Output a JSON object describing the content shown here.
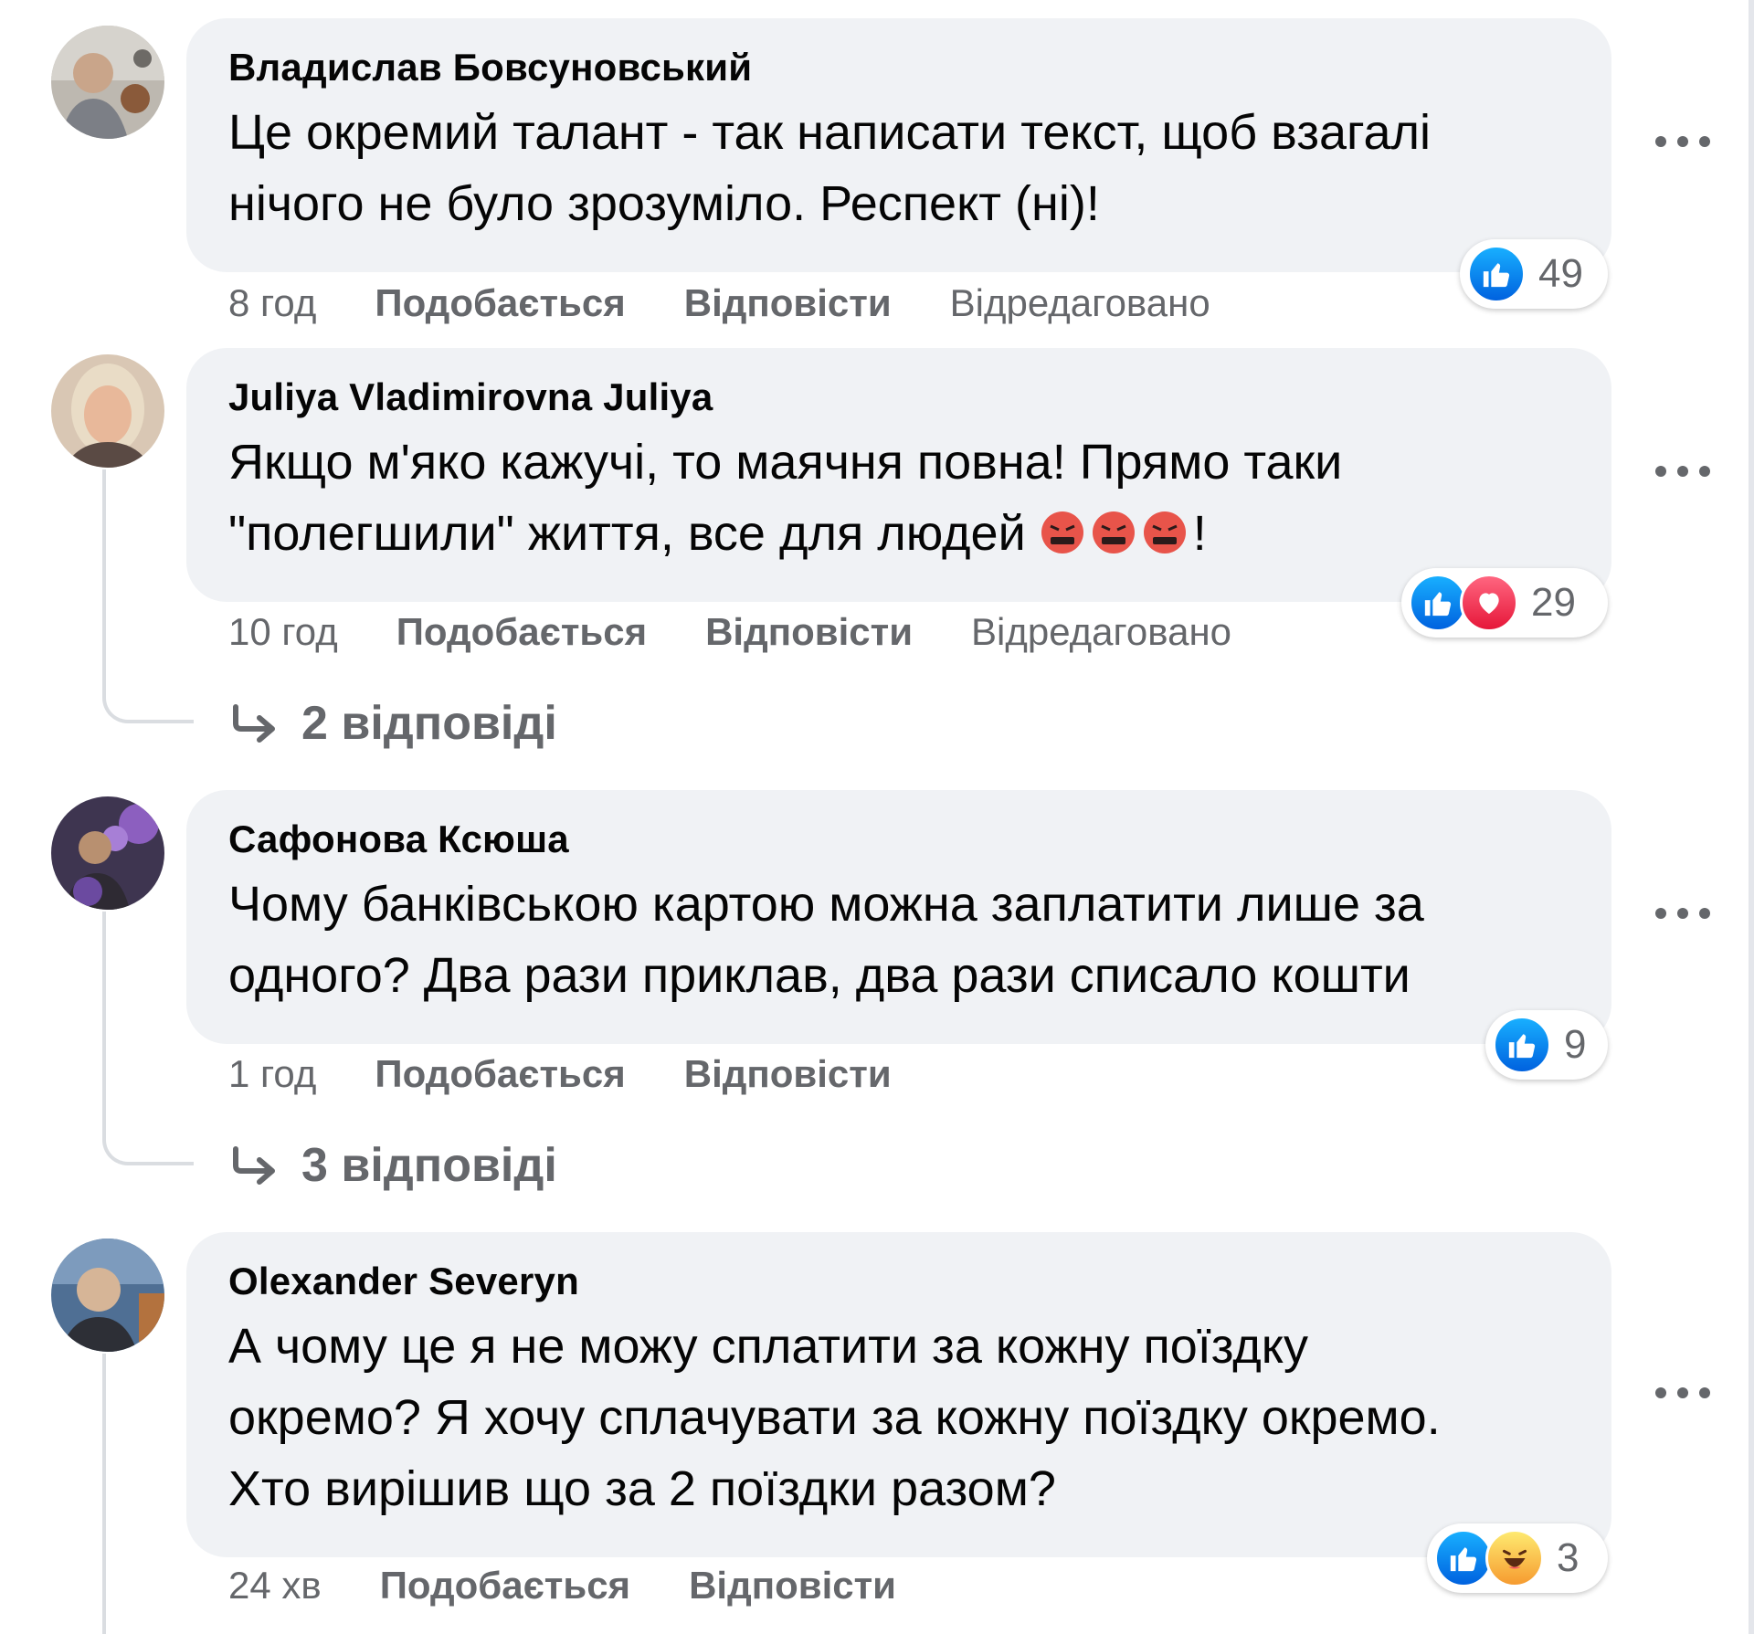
{
  "comments": [
    {
      "author": "Владислав Бовсуновський",
      "text": "Це окремий талант - так написати текст, щоб взагалі\nнічого не було зрозуміло. Респект (ні)!",
      "reactions": {
        "icons": [
          "like"
        ],
        "count": "49"
      },
      "time": "8 год",
      "like_label": "Подобається",
      "reply_label": "Відповісти",
      "edited_label": "Відредаговано",
      "avatar_colors": [
        "#8a8a8a",
        "#c8c4be"
      ]
    },
    {
      "author": "Juliya Vladimirovna Juliya",
      "text_before": "Якщо м'яко кажучі, то маячня повна! Прямо таки\n\"полегшили\" життя, все для людей ",
      "text_after": "!",
      "emoji": "face-with-symbols-on-mouth-emoji",
      "reactions": {
        "icons": [
          "like",
          "love"
        ],
        "count": "29"
      },
      "time": "10 год",
      "like_label": "Подобається",
      "reply_label": "Відповісти",
      "edited_label": "Відредаговано",
      "replies_label": "2 відповіді",
      "avatar_colors": [
        "#d9c7b4",
        "#f1e7d8"
      ]
    },
    {
      "author": "Сафонова Ксюша",
      "text": "Чому банківською картою можна заплатити лише за\nодного? Два рази приклав, два рази списало кошти",
      "reactions": {
        "icons": [
          "like"
        ],
        "count": "9"
      },
      "time": "1 год",
      "like_label": "Подобається",
      "reply_label": "Відповісти",
      "replies_label": "3 відповіді",
      "avatar_colors": [
        "#4a3a5a",
        "#9a6fc0"
      ]
    },
    {
      "author": "Olexander Severyn",
      "text": "А чому це я не можу сплатити за кожну поїздку\nокремо? Я хочу сплачувати за кожну поїздку окремо.\nХто вирішив що за 2 поїздки разом?",
      "reactions": {
        "icons": [
          "like",
          "haha"
        ],
        "count": "3"
      },
      "time": "24 хв",
      "like_label": "Подобається",
      "reply_label": "Відповісти",
      "avatar_colors": [
        "#3d5a7a",
        "#c9b59a"
      ]
    }
  ],
  "colors": {
    "bubble": "#f0f2f5",
    "secondary_text": "#65676b",
    "like_blue": "#1877f2",
    "love_red": "#f33e58",
    "thread_line": "#dadde1"
  }
}
